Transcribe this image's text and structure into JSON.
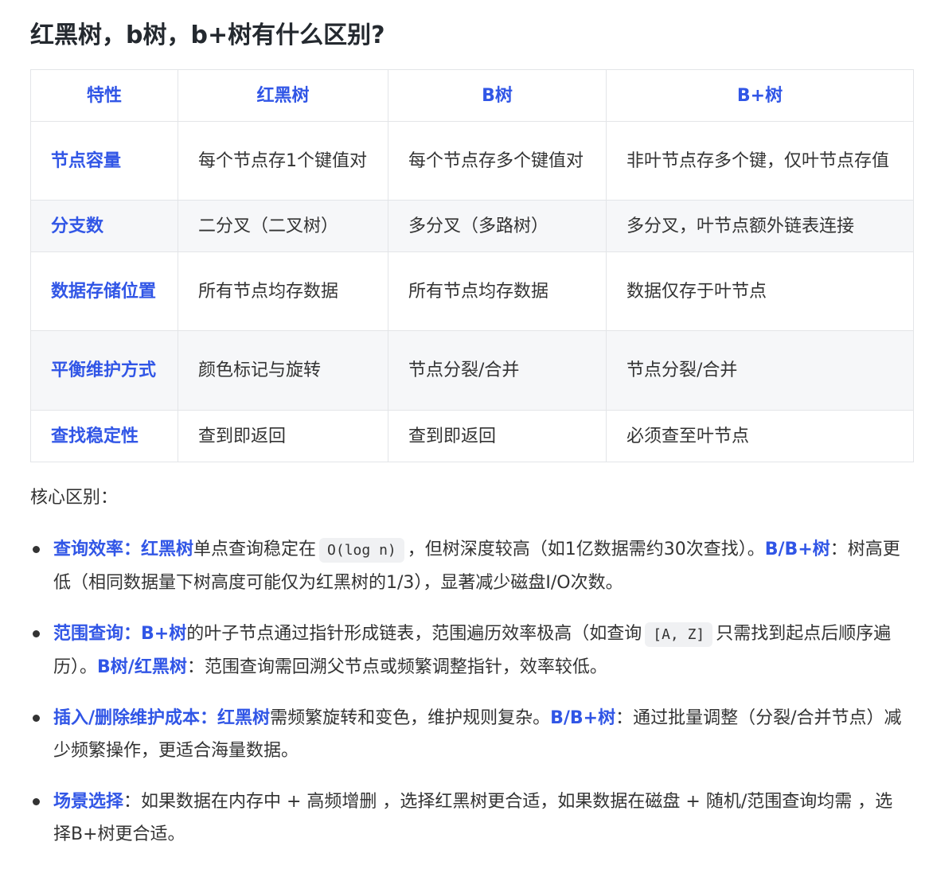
{
  "title": "红黑树，b树，b+树有什么区别?",
  "table": {
    "headers": [
      "特性",
      "红黑树",
      "B树",
      "B+树"
    ],
    "rows": [
      {
        "feature": "节点容量",
        "rbtree": "每个节点存1个键值对",
        "btree": "每个节点存多个键值对",
        "bplus": "非叶节点存多个键，仅叶节点存值"
      },
      {
        "feature": "分支数",
        "rbtree": "二分叉（二叉树）",
        "btree": "多分叉（多路树）",
        "bplus": "多分叉，叶节点额外链表连接"
      },
      {
        "feature": "数据存储位置",
        "rbtree": "所有节点均存数据",
        "btree": "所有节点均存数据",
        "bplus": "数据仅存于叶节点"
      },
      {
        "feature": "平衡维护方式",
        "rbtree": "颜色标记与旋转",
        "btree": "节点分裂/合并",
        "bplus": "节点分裂/合并"
      },
      {
        "feature": "查找稳定性",
        "rbtree": "查到即返回",
        "btree": "查到即返回",
        "bplus": "必须查至叶节点"
      }
    ]
  },
  "summary_label": "核心区别：",
  "points": [
    {
      "label": "查询效率：",
      "parts": [
        {
          "hl": "红黑树"
        },
        {
          "t": "单点查询稳定在"
        },
        {
          "code": "O(log n)"
        },
        {
          "t": "，但树深度较高（如1亿数据需约30次查找）。"
        },
        {
          "hl": "B/B+树"
        },
        {
          "t": "：树高更低（相同数据量下树高度可能仅为红黑树的1/3），显著减少磁盘I/O次数。"
        }
      ]
    },
    {
      "label": "范围查询：",
      "parts": [
        {
          "hl": "B+树"
        },
        {
          "t": "的叶子节点通过指针形成链表，范围遍历效率极高（如查询"
        },
        {
          "code": "[A, Z]"
        },
        {
          "t": "只需找到起点后顺序遍历）。"
        },
        {
          "hl": "B树/红黑树"
        },
        {
          "t": "：范围查询需回溯父节点或频繁调整指针，效率较低。"
        }
      ]
    },
    {
      "label": "插入/删除维护成本：",
      "parts": [
        {
          "hl": "红黑树"
        },
        {
          "t": "需频繁旋转和变色，维护规则复杂。"
        },
        {
          "hl": "B/B+树"
        },
        {
          "t": "：通过批量调整（分裂/合并节点）减少频繁操作，更适合海量数据。"
        }
      ]
    },
    {
      "label": "场景选择",
      "parts": [
        {
          "t": "：如果数据在内存中 + 高频增删 ，选择红黑树更合适，如果数据在磁盘 + 随机/范围查询均需 ，选择B+树更合适。"
        }
      ]
    }
  ]
}
